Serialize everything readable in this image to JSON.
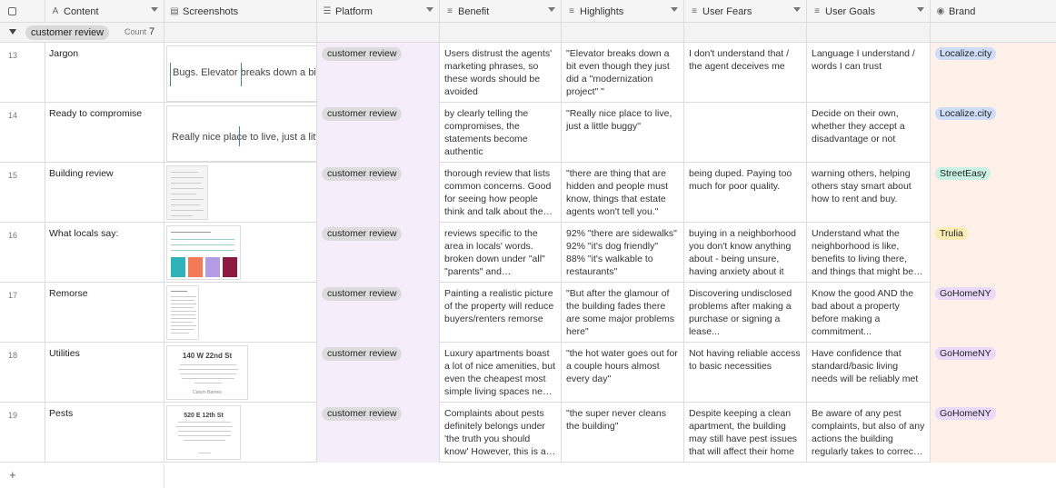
{
  "columns": {
    "content": "Content",
    "screenshots": "Screenshots",
    "platform": "Platform",
    "benefit": "Benefit",
    "highlights": "Highlights",
    "user_fears": "User Fears",
    "user_goals": "User Goals",
    "brand": "Brand"
  },
  "group": {
    "label": "customer review",
    "count_label": "Count",
    "count": "7"
  },
  "colors": {
    "localize": "#cfdcf7",
    "streeteasy": "#c9f1e4",
    "trulia": "#fbecb4",
    "gohomeny": "#ead9f8",
    "platform_bg": "#f5eefa",
    "brand_bg": "#fdf0e9"
  },
  "rows": [
    {
      "num": "13",
      "content": "Jargon",
      "platform": "customer review",
      "thumb_text": "Bugs. Elevator breaks down a bit e",
      "benefit": "Users distrust the agents' marketing phrases, so these words should be avoided",
      "highlights": "\"Elevator breaks down a bit even though they just did a \"modernization project\" \"",
      "fears": "I don't understand that / the agent deceives me",
      "goals": "Language I understand / words I can trust",
      "brand": "Localize.city"
    },
    {
      "num": "14",
      "content": "Ready to compromise",
      "platform": "customer review",
      "thumb_text": "Really nice place to live, just a little",
      "benefit": "by clearly telling the compromises, the statements become authentic",
      "highlights": "\"Really nice place to live, just a little buggy\"",
      "fears": "",
      "goals": "Decide on their own, whether they accept a disadvantage or not",
      "brand": "Localize.city"
    },
    {
      "num": "15",
      "content": "Building review",
      "platform": "customer review",
      "benefit": "thorough review that lists common concerns. Good for seeing how people think and talk about the building",
      "highlights": "\"there are thing that are hidden and people must know, things that estate agents won't tell you.\"",
      "fears": "being duped. Paying too much for poor quality.",
      "goals": "warning others, helping others stay smart about how to rent and buy.",
      "brand": "StreetEasy"
    },
    {
      "num": "16",
      "content": "What locals say:",
      "platform": "customer review",
      "benefit": "reviews specific to the area in locals' words. broken down under \"all\" \"parents\" and \"commuters\"",
      "highlights": "92% \"there are sidewalks\" 92% \"it's dog friendly\" 88% \"it's walkable to restaurants\"",
      "fears": "buying in a neighborhood you don't know anything about - being unsure, having anxiety about it",
      "goals": "Understand what the neighborhood is like, benefits to living there, and things that might be a problem",
      "brand": "Trulia"
    },
    {
      "num": "17",
      "content": "Remorse",
      "platform": "customer review",
      "benefit": "Painting a realistic picture of the property will reduce buyers/renters remorse",
      "highlights": "\"But after the glamour of the building fades there are some major problems here\"",
      "fears": "Discovering undisclosed problems after making a purchase or signing a lease...",
      "goals": "Know the good AND the bad about a property before making a commitment...",
      "brand": "GoHomeNY"
    },
    {
      "num": "18",
      "content": "Utilities",
      "platform": "customer review",
      "thumb_addr": "140 W 22nd St",
      "thumb_author": "Calum Barnes",
      "benefit": "Luxury apartments boast a lot of nice amenities, but even the cheapest most simple living spaces need basic utilities",
      "highlights": "\"the hot water goes out for a couple hours almost every day\"",
      "fears": "Not having reliable access to basic necessities",
      "goals": "Have confidence that standard/basic living needs will be reliably met",
      "brand": "GoHomeNY"
    },
    {
      "num": "19",
      "content": "Pests",
      "platform": "customer review",
      "thumb_addr": "520 E 12th St",
      "benefit": "Complaints about pests definitely belongs under 'the truth you should know' However, this is a common issue",
      "highlights": "\"the super never cleans the building\"",
      "fears": "Despite keeping a clean apartment, the building may still have pest issues that will affect their home",
      "goals": "Be aware of any pest complaints, but also of any actions the building regularly takes to correct them",
      "brand": "GoHomeNY"
    }
  ]
}
